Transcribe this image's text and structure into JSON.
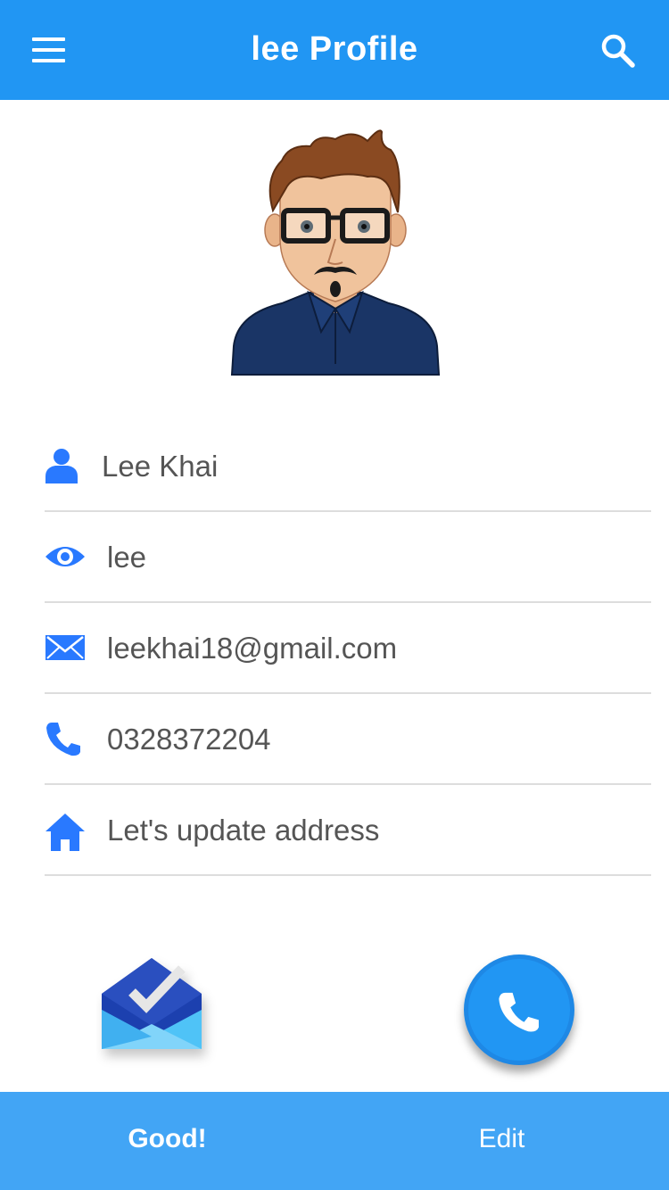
{
  "header": {
    "title": "lee Profile",
    "menu_icon": "hamburger-menu-icon",
    "search_icon": "search-icon"
  },
  "profile": {
    "avatar": "cartoon-avatar",
    "fields": [
      {
        "icon": "person-icon",
        "value": "Lee Khai"
      },
      {
        "icon": "eye-icon",
        "value": "lee"
      },
      {
        "icon": "mail-icon",
        "value": "leekhai18@gmail.com"
      },
      {
        "icon": "phone-icon",
        "value": "0328372204"
      },
      {
        "icon": "home-icon",
        "value": "Let's update address"
      }
    ]
  },
  "actions": {
    "inbox_icon": "inbox-app-icon",
    "call_icon": "phone-icon"
  },
  "bottom_bar": {
    "left_label": "Good!",
    "right_label": "Edit"
  },
  "colors": {
    "primary": "#2196f3",
    "bottom_bar": "#42a5f5",
    "icon": "#2979ff",
    "text": "#555555",
    "divider": "#dddddd"
  }
}
